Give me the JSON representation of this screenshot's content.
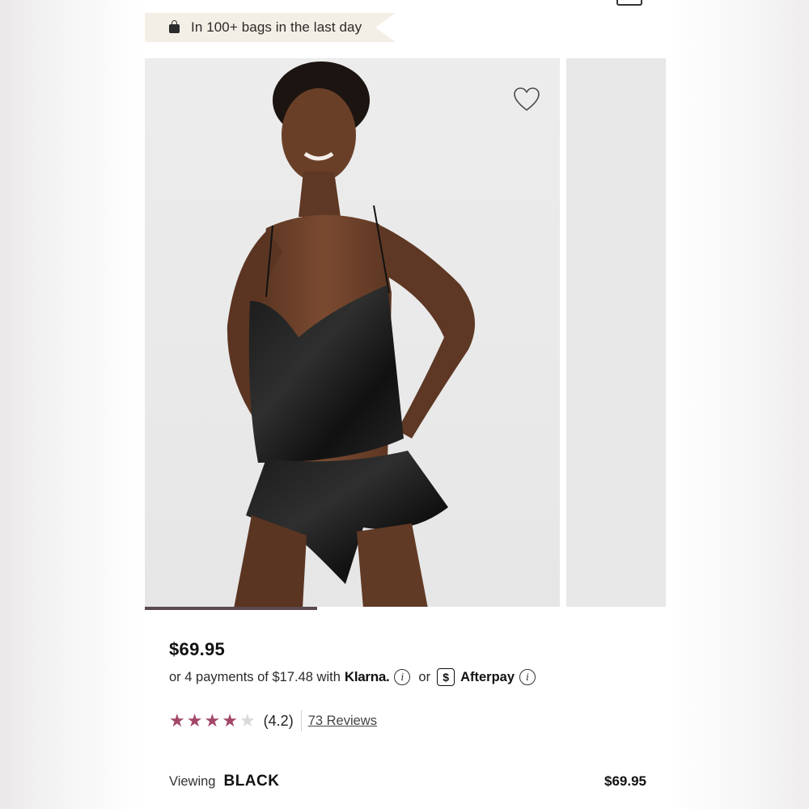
{
  "header": {
    "social_proof": "In 100+ bags in the last day",
    "bag_icon": "shopping-bag-icon"
  },
  "gallery": {
    "wishlist_icon": "heart-icon",
    "slide_count_visible": 2,
    "progress": 0.33
  },
  "product": {
    "price": "$69.95",
    "installments_prefix": "or 4 payments of $17.48 with",
    "klarna_label": "Klarna.",
    "or_label": "or",
    "afterpay_symbol": "$",
    "afterpay_label": "Afterpay",
    "info_glyph": "i"
  },
  "rating": {
    "value": 4.2,
    "display": "(4.2)",
    "stars_max": 5,
    "reviews_link": "73 Reviews",
    "star_color": "#a3476a"
  },
  "selection": {
    "viewing_label": "Viewing",
    "color_name": "BLACK",
    "price": "$69.95"
  }
}
